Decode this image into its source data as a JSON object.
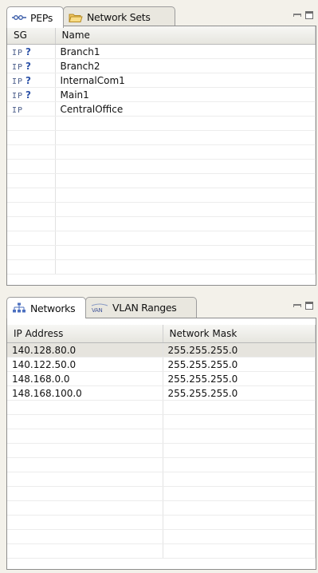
{
  "top_view": {
    "tabs": [
      {
        "label": "PEPs",
        "icon": "pep-link-icon",
        "active": true
      },
      {
        "label": "Network Sets",
        "icon": "folder-open-icon",
        "active": false
      }
    ],
    "columns": [
      "SG",
      "Name"
    ],
    "rows": [
      {
        "sg": "IP",
        "q": "?",
        "name": "Branch1"
      },
      {
        "sg": "IP",
        "q": "?",
        "name": "Branch2"
      },
      {
        "sg": "IP",
        "q": "?",
        "name": "InternalCom1"
      },
      {
        "sg": "IP",
        "q": "?",
        "name": "Main1"
      },
      {
        "sg": "IP",
        "q": "",
        "name": "CentralOffice"
      }
    ]
  },
  "bottom_view": {
    "tabs": [
      {
        "label": "Networks",
        "icon": "network-tree-icon",
        "active": true
      },
      {
        "label": "VLAN Ranges",
        "icon": "vlan-icon",
        "active": false
      }
    ],
    "vlan_icon_text": "VAN",
    "columns": [
      "IP Address",
      "Network Mask"
    ],
    "rows": [
      {
        "ip": "140.128.80.0",
        "mask": "255.255.255.0"
      },
      {
        "ip": "140.122.50.0",
        "mask": "255.255.255.0"
      },
      {
        "ip": "148.168.0.0",
        "mask": "255.255.255.0"
      },
      {
        "ip": "148.168.100.0",
        "mask": "255.255.255.0"
      }
    ]
  }
}
